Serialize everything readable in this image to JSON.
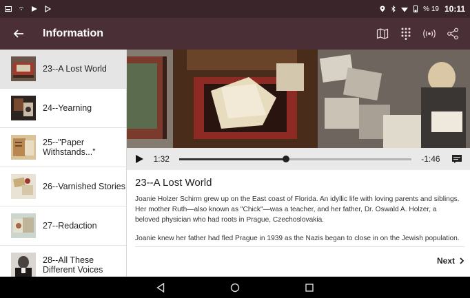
{
  "status_bar": {
    "time": "10:11",
    "battery_text": "% 19"
  },
  "app_bar": {
    "title": "Information"
  },
  "sidebar": {
    "items": [
      {
        "label": "23--A Lost World",
        "active": true
      },
      {
        "label": "24--Yearning",
        "active": false
      },
      {
        "label": "25--\"Paper Withstands...\"",
        "active": false
      },
      {
        "label": "26--Varnished Stories",
        "active": false
      },
      {
        "label": "27--Redaction",
        "active": false
      },
      {
        "label": "28--All These Different Voices",
        "active": false
      }
    ]
  },
  "player": {
    "elapsed": "1:32",
    "remaining": "-1:46",
    "progress": 0.46
  },
  "article": {
    "title": "23--A Lost World",
    "paragraph1": "Joanie Holzer Schirm grew up on the East coast of Florida. An idyllic life with loving parents and siblings. Her mother Ruth—also known as \"Chick\"—was a teacher, and her father, Dr. Oswald A. Holzer, a beloved physician who had roots in Prague, Czechoslovakia.",
    "paragraph2": "Joanie knew her father had fled Prague in 1939 as the Nazis began to close in on the Jewish population.",
    "next_label": "Next"
  },
  "colors": {
    "status_bar": "#3a252b",
    "app_bar": "#4a2f36",
    "nav_bar": "#000000",
    "player_bg": "#e9e9e9",
    "active_item": "#e5e5e5"
  }
}
